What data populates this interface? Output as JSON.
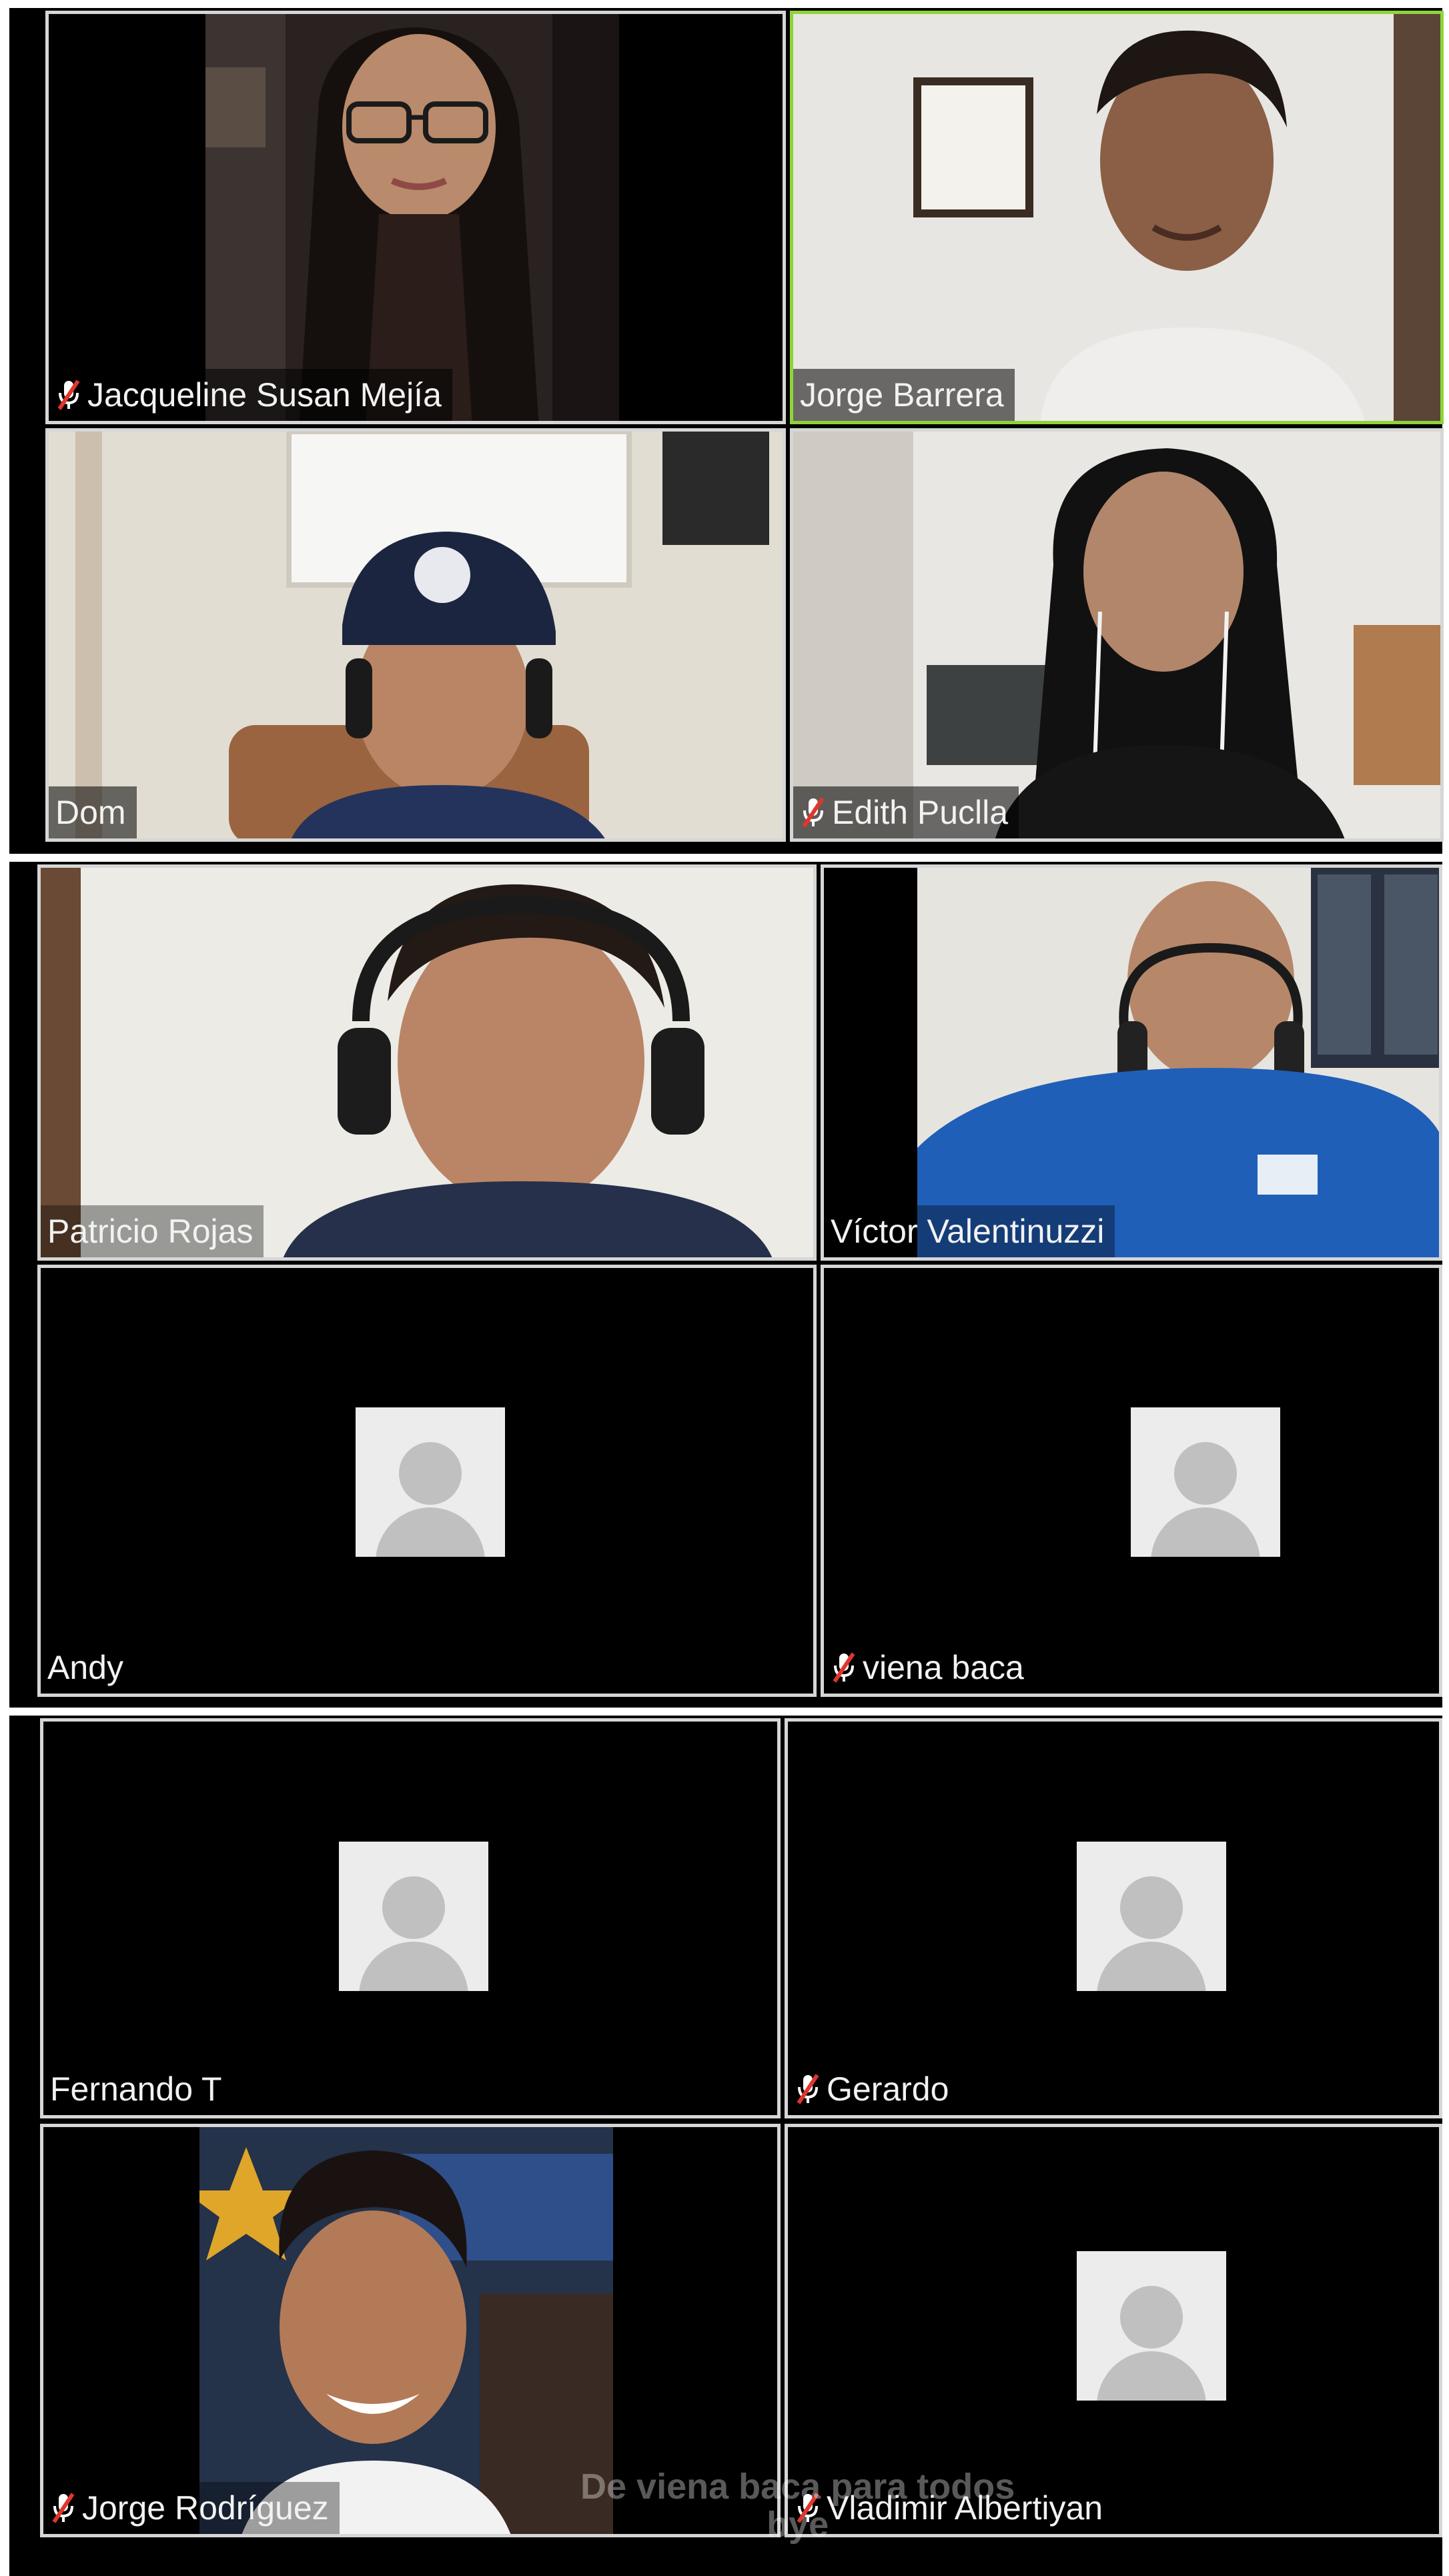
{
  "participants": [
    {
      "name": "Jacqueline Susan Mejía",
      "muted": true,
      "video": "on",
      "speaking": false
    },
    {
      "name": "Jorge Barrera",
      "muted": false,
      "video": "on",
      "speaking": true
    },
    {
      "name": "Dom",
      "muted": false,
      "video": "on",
      "speaking": false
    },
    {
      "name": "Edith Puclla",
      "muted": true,
      "video": "on",
      "speaking": false
    },
    {
      "name": "Patricio Rojas",
      "muted": false,
      "video": "on",
      "speaking": false
    },
    {
      "name": "Víctor Valentinuzzi",
      "muted": false,
      "video": "on",
      "speaking": false
    },
    {
      "name": "Andy",
      "muted": false,
      "video": "off",
      "speaking": false
    },
    {
      "name": "viena baca",
      "muted": true,
      "video": "off",
      "speaking": false
    },
    {
      "name": "Fernando T",
      "muted": false,
      "video": "off",
      "speaking": false
    },
    {
      "name": "Gerardo",
      "muted": true,
      "video": "off",
      "speaking": false
    },
    {
      "name": "Jorge Rodríguez",
      "muted": true,
      "video": "on",
      "speaking": false
    },
    {
      "name": "Vladimir Albertiyan",
      "muted": true,
      "video": "off",
      "speaking": false
    }
  ],
  "chat_overlay": {
    "line1": "De viena baca para todos",
    "line2": "bye"
  },
  "colors": {
    "active_speaker_border": "#8fd33a",
    "tile_border": "#d6d6d6",
    "mute_icon": "#e0362c",
    "background": "#000000"
  },
  "icons": {
    "muted": "mic-muted-icon",
    "no_video": "default-avatar-icon"
  }
}
